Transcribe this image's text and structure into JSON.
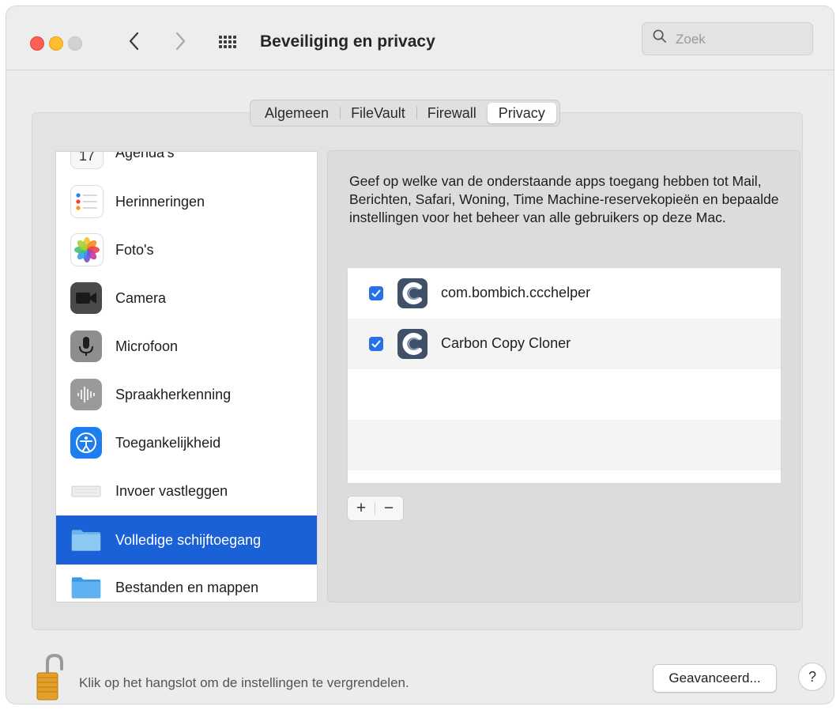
{
  "window": {
    "title": "Beveiliging en privacy",
    "search_placeholder": "Zoek"
  },
  "tabs": [
    {
      "label": "Algemeen"
    },
    {
      "label": "FileVault"
    },
    {
      "label": "Firewall"
    },
    {
      "label": "Privacy",
      "active": true
    }
  ],
  "sidebar": {
    "items": [
      {
        "label": "Agenda's",
        "icon": "calendar-icon"
      },
      {
        "label": "Herinneringen",
        "icon": "reminders-icon"
      },
      {
        "label": "Foto's",
        "icon": "photos-icon"
      },
      {
        "label": "Camera",
        "icon": "camera-icon"
      },
      {
        "label": "Microfoon",
        "icon": "microphone-icon"
      },
      {
        "label": "Spraakherkenning",
        "icon": "speech-recognition-icon"
      },
      {
        "label": "Toegankelijkheid",
        "icon": "accessibility-icon"
      },
      {
        "label": "Invoer vastleggen",
        "icon": "keyboard-icon"
      },
      {
        "label": "Volledige schijftoegang",
        "icon": "folder-icon",
        "selected": true
      },
      {
        "label": "Bestanden en mappen",
        "icon": "folder-icon"
      }
    ]
  },
  "main": {
    "description": "Geef op welke van de onderstaande apps toegang hebben tot Mail, Berichten, Safari, Woning, Time Machine-reservekopieën en bepaalde instellingen voor het beheer van alle gebruikers op deze Mac.",
    "apps": [
      {
        "name": "com.bombich.ccchelper",
        "checked": true,
        "icon": "carbon-copy-cloner-icon"
      },
      {
        "name": "Carbon Copy Cloner",
        "checked": true,
        "icon": "carbon-copy-cloner-icon"
      }
    ],
    "add_label": "+",
    "remove_label": "−"
  },
  "footer": {
    "lock_text": "Klik op het hangslot om de instellingen te vergrendelen.",
    "advanced_label": "Geavanceerd...",
    "help_label": "?"
  },
  "colors": {
    "selection": "#1a60d6",
    "checkbox": "#2671e5"
  }
}
